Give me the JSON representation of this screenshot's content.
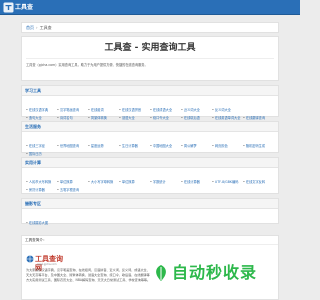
{
  "topbar": {
    "title": "工具查"
  },
  "breadcrumb": {
    "home": "首页",
    "current": "工具查"
  },
  "hero": {
    "title": "工具查 - 实用查询工具",
    "intro": "工具查（gjcha.com）实用查询工具，助力于为用户提供方便、快捷的在线查询服务。"
  },
  "sections": [
    {
      "title": "学习工具",
      "rows": [
        [
          "在线汉语字典",
          "汉字笔画查询",
          "在线组词",
          "在线汉语拼音",
          "在线成语大全",
          "近义词大全",
          "反义词大全"
        ],
        [
          "造句大全",
          "诗词名句",
          "简繁体转换",
          "谜语大全",
          "绕口令大全",
          "在线歇后语",
          "在线英语单词大全",
          "在线翻译查询"
        ]
      ]
    },
    {
      "title": "生活服务",
      "rows": [
        [
          "在线三字经",
          "世界地图查询",
          "星座运势",
          "生日计算器",
          "中国地图大全",
          "周公解梦",
          "网页颜色",
          "随机密码生成"
        ],
        [
          "国际日历"
        ]
      ]
    },
    {
      "title": "实用计算",
      "rows": [
        [
          "人民币大写转换",
          "单位换算",
          "大小写字母转换",
          "单位换算",
          "字数统计",
          "在线计算器",
          "UTF-8/GBK编码",
          "在线文字反转"
        ],
        [
          "房贷计算器",
          "五笔字根查询"
        ]
      ]
    },
    {
      "title": "摄影专区",
      "rows": [
        [
          "在线摄影大图"
        ]
      ]
    }
  ],
  "about": {
    "heading": "工具查简介：",
    "logo_cn": "工具查询网",
    "logo_en": "www.gjcha.com",
    "desc_lines": [
      "为大家提供汉语字典、汉字笔画查询、在线组词、汉语拼音、近义词、反义词、成语大全、",
      "天大天高等平台、及中国大全、简繁体转换、谜语大全查询、绕口令、歇后语、在线翻译等",
      "方大实用测试工具、国际农历大全、NBA解码查询、天天大日常测试工具、学校查询等等。"
    ]
  },
  "watermark": {
    "text": "自动秒收录"
  },
  "colors": {
    "link": "#2a6fb7",
    "topbar": "#2a6fb7",
    "watermark": "#2db84b",
    "logo_red": "#c0392b"
  }
}
